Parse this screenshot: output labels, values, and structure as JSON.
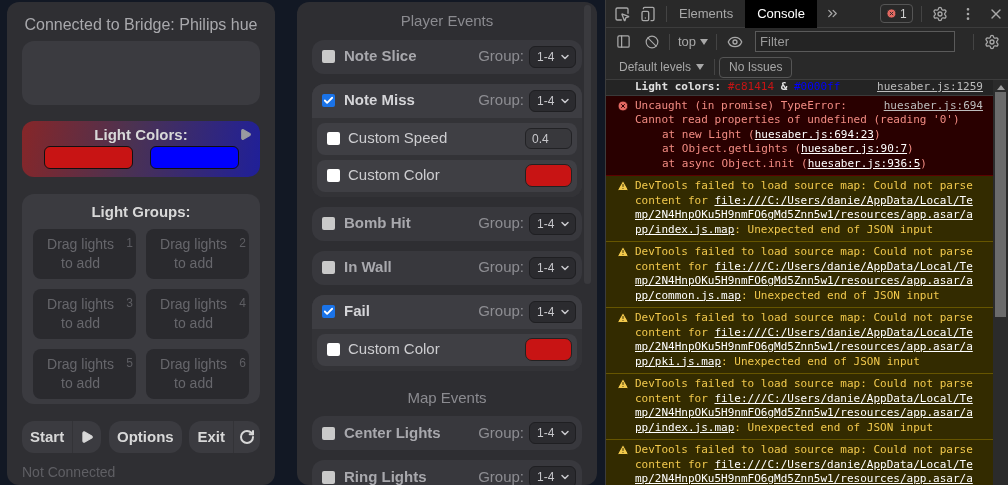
{
  "app": {
    "bridge_title": "Connected to Bridge: Philips hue",
    "light_colors": {
      "title": "Light Colors:",
      "colors": [
        {
          "color": "#c81414"
        },
        {
          "color": "#0000ff"
        }
      ]
    },
    "light_groups": {
      "title": "Light Groups:",
      "slots": [
        {
          "placeholder": "Drag lights to add",
          "number": "1"
        },
        {
          "placeholder": "Drag lights to add",
          "number": "2"
        },
        {
          "placeholder": "Drag lights to add",
          "number": "3"
        },
        {
          "placeholder": "Drag lights to add",
          "number": "4"
        },
        {
          "placeholder": "Drag lights to add",
          "number": "5"
        },
        {
          "placeholder": "Drag lights to add",
          "number": "6"
        }
      ]
    },
    "buttons": [
      {
        "label": "Start",
        "kind": "start"
      },
      {
        "label": "Options",
        "kind": "plain"
      },
      {
        "label": "Exit",
        "kind": "exit"
      }
    ],
    "status": "Not Connected"
  },
  "events_panel": {
    "sections": [
      {
        "title": "Player Events",
        "events": [
          {
            "label": "Note Slice",
            "checked": false,
            "group_label": "Group:",
            "group": "1-4"
          },
          {
            "label": "Note Miss",
            "checked": true,
            "group_label": "Group:",
            "group": "1-4",
            "options": [
              {
                "kind": "speed",
                "label": "Custom Speed",
                "checked": false,
                "value": "0.4"
              },
              {
                "kind": "color",
                "label": "Custom Color",
                "checked": false,
                "color": "#c81414"
              }
            ]
          },
          {
            "label": "Bomb Hit",
            "checked": false,
            "group_label": "Group:",
            "group": "1-4"
          },
          {
            "label": "In Wall",
            "checked": false,
            "group_label": "Group:",
            "group": "1-4"
          },
          {
            "label": "Fail",
            "checked": true,
            "group_label": "Group:",
            "group": "1-4",
            "options": [
              {
                "kind": "color",
                "label": "Custom Color",
                "checked": false,
                "color": "#c81414"
              }
            ]
          }
        ]
      },
      {
        "title": "Map Events",
        "events": [
          {
            "label": "Center Lights",
            "checked": false,
            "group_label": "Group:",
            "group": "1-4"
          },
          {
            "label": "Ring Lights",
            "checked": false,
            "group_label": "Group:",
            "group": "1-4"
          }
        ]
      }
    ]
  },
  "devtools": {
    "tabs": [
      {
        "label": "Elements",
        "selected": false
      },
      {
        "label": "Console",
        "selected": true
      }
    ],
    "error_count": "1",
    "context": "top",
    "filter": {
      "placeholder": "Filter"
    },
    "levels": "Default levels",
    "issues": "No Issues",
    "messages": [
      {
        "kind": "log",
        "parts": [
          {
            "text": "Light colors: "
          },
          {
            "text": "#c81414",
            "color": "#c81414"
          },
          {
            "text": " & "
          },
          {
            "text": "#0000ff",
            "color": "#0000ff"
          }
        ],
        "source": "huesaber.js:1259"
      },
      {
        "kind": "error",
        "text": "Uncaught (in promise) TypeError:",
        "source": "huesaber.js:694",
        "detail": "Cannot read properties of undefined (reading '0')",
        "stack": [
          {
            "text": "at new Light (",
            "link": "huesaber.js:694:23",
            "end": ")"
          },
          {
            "text": "at Object.getLights (",
            "link": "huesaber.js:90:7",
            "end": ")"
          },
          {
            "text": "at async Object.init (",
            "link": "huesaber.js:936:5",
            "end": ")"
          }
        ]
      },
      {
        "kind": "warning",
        "text": "DevTools failed to load source map: Could not parse content for ",
        "link": "file:///C:/Users/danie/AppData/Local/Temp/2N4HnpOKu5H9nmFO6gMd5Znn5w1/resources/app.asar/app/index.js.map",
        "end": ": Unexpected end of JSON input"
      },
      {
        "kind": "warning",
        "text": "DevTools failed to load source map: Could not parse content for ",
        "link": "file:///C:/Users/danie/AppData/Local/Temp/2N4HnpOKu5H9nmFO6gMd5Znn5w1/resources/app.asar/app/common.js.map",
        "end": ": Unexpected end of JSON input"
      },
      {
        "kind": "warning",
        "text": "DevTools failed to load source map: Could not parse content for ",
        "link": "file:///C:/Users/danie/AppData/Local/Temp/2N4HnpOKu5H9nmFO6gMd5Znn5w1/resources/app.asar/app/pki.js.map",
        "end": ": Unexpected end of JSON input"
      },
      {
        "kind": "warning",
        "text": "DevTools failed to load source map: Could not parse content for ",
        "link": "file:///C:/Users/danie/AppData/Local/Temp/2N4HnpOKu5H9nmFO6gMd5Znn5w1/resources/app.asar/app/index.js.map",
        "end": ": Unexpected end of JSON input"
      },
      {
        "kind": "warning",
        "text": "DevTools failed to load source map: Could not parse content for ",
        "link": "file:///C:/Users/danie/AppData/Local/Temp/2N4HnpOKu5H9nmFO6gMd5Znn5w1/resources/app.asar/a"
      }
    ]
  }
}
